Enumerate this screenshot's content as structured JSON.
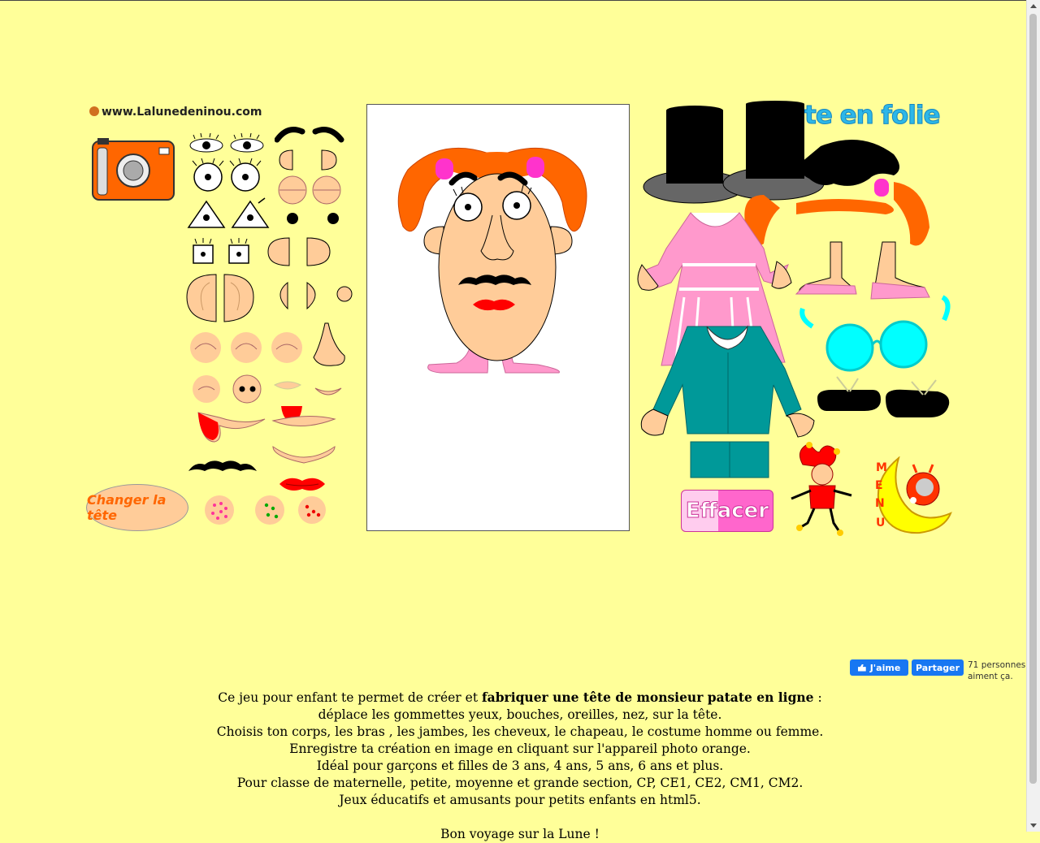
{
  "site": {
    "name": "www.Lalunedeninou.com"
  },
  "game": {
    "title_fragment": "te en folie"
  },
  "buttons": {
    "change_head": "Changer la tête",
    "erase": "Effacer",
    "menu_letters": [
      "M",
      "E",
      "N",
      "U"
    ]
  },
  "facebook": {
    "like": "J'aime",
    "share": "Partager",
    "count_line1": "71 personnes",
    "count_line2": "aiment ça."
  },
  "description": {
    "line1_pre": "Ce jeu pour enfant te permet de créer et ",
    "line1_bold": "fabriquer une tête de monsieur patate en ligne",
    "line1_post": " :",
    "line2": "déplace les gommettes yeux, bouches, oreilles, nez, sur la tête.",
    "line3": "Choisis ton corps, les bras , les jambes, les cheveux, le chapeau, le costume homme ou femme.",
    "line4": "Enregistre ta création en image en cliquant sur l'appareil photo orange.",
    "line5": "Idéal pour garçons et filles de 3 ans, 4 ans, 5 ans, 6 ans et plus.",
    "line6": "Pour classe de maternelle, petite, moyenne et grande section, CP, CE1, CE2, CM1, CM2.",
    "line7": "Jeux éducatifs et amusants pour petits enfants en html5.",
    "line8": "Bon voyage sur la Lune !"
  },
  "colors": {
    "background": "#ffff99",
    "skin": "#ffcc99",
    "hair": "#ff6600",
    "pink": "#ff99cc",
    "suit": "#009999",
    "glasses": "#00ffff",
    "camera": "#ff6600"
  }
}
